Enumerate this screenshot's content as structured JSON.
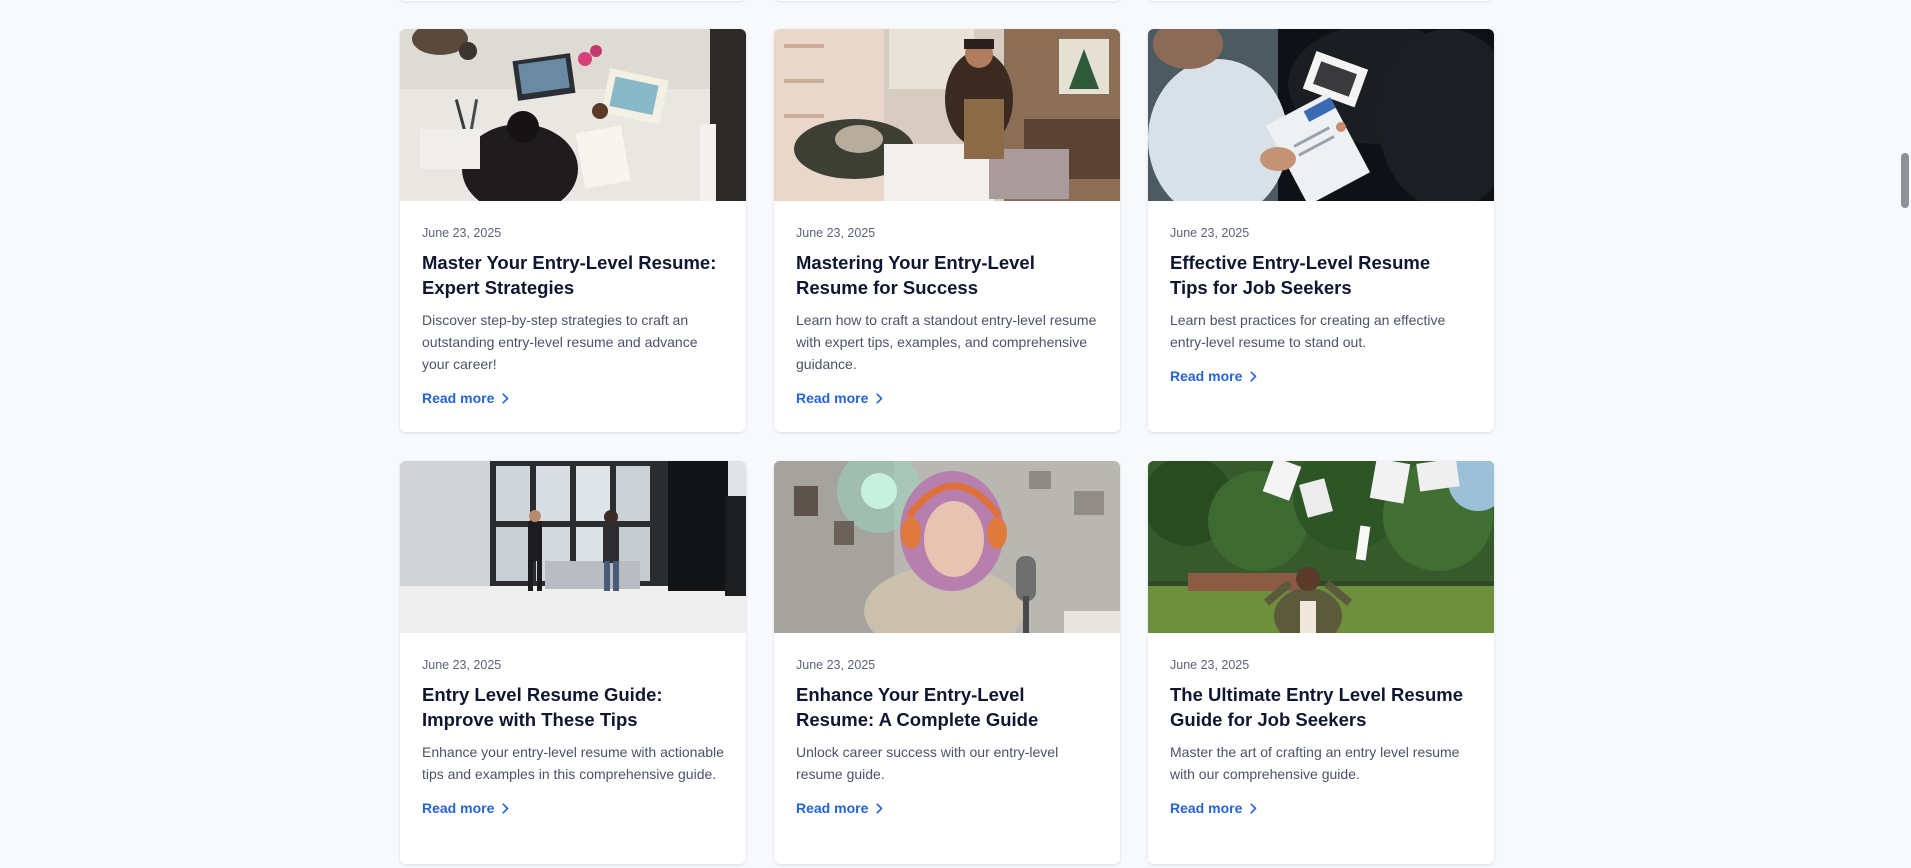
{
  "articles": [
    {
      "date": "June 23, 2025",
      "title": "Master Your Entry-Level Resume: Expert Strategies",
      "description": "Discover step-by-step strategies to craft an outstanding entry-level resume and advance your career!",
      "link": "Read more",
      "image": "desk-drawing-overhead"
    },
    {
      "date": "June 23, 2025",
      "title": "Mastering Your Entry-Level Resume for Success",
      "description": "Learn how to craft a standout entry-level resume with expert tips, examples, and comprehensive guidance.",
      "link": "Read more",
      "image": "man-at-table-interior"
    },
    {
      "date": "June 23, 2025",
      "title": "Effective Entry-Level Resume Tips for Job Seekers",
      "description": "Learn best practices for creating an effective entry-level resume to stand out.",
      "link": "Read more",
      "image": "resume-on-clipboard"
    },
    {
      "date": "June 23, 2025",
      "title": "Entry Level Resume Guide: Improve with These Tips",
      "description": "Enhance your entry-level resume with actionable tips and examples in this comprehensive guide.",
      "link": "Read more",
      "image": "photo-studio-window"
    },
    {
      "date": "June 23, 2025",
      "title": "Enhance Your Entry-Level Resume: A Complete Guide",
      "description": "Unlock career success with our entry-level resume guide.",
      "link": "Read more",
      "image": "podcaster-headphones"
    },
    {
      "date": "June 23, 2025",
      "title": "The Ultimate Entry Level Resume Guide for Job Seekers",
      "description": "Master the art of crafting an entry level resume with our comprehensive guide.",
      "link": "Read more",
      "image": "man-throwing-papers-park"
    }
  ],
  "colors": {
    "background": "#f7f9fc",
    "link": "#2563d8",
    "title": "#0f1730",
    "text": "#4b5367"
  }
}
